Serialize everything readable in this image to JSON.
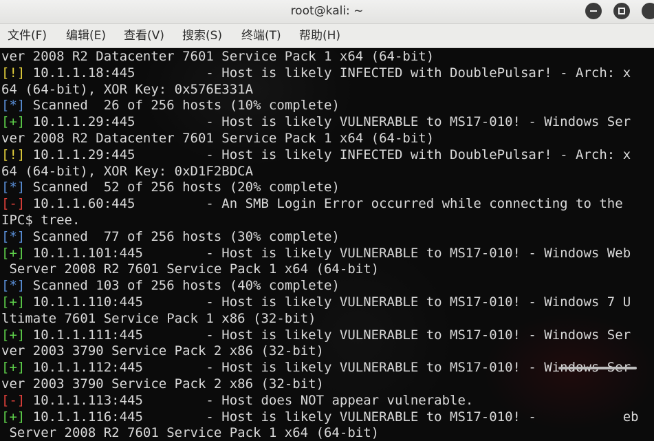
{
  "window": {
    "title": "root@kali: ~"
  },
  "menubar": {
    "items": [
      "文件(F)",
      "编辑(E)",
      "查看(V)",
      "搜索(S)",
      "终端(T)",
      "帮助(H)"
    ]
  },
  "terminal": {
    "lines": [
      {
        "tag": "",
        "text": "ver 2008 R2 Datacenter 7601 Service Pack 1 x64 (64-bit)"
      },
      {
        "tag": "[!]",
        "text": " 10.1.1.18:445         - Host is likely INFECTED with DoublePulsar! - Arch: x"
      },
      {
        "tag": "",
        "text": "64 (64-bit), XOR Key: 0x576E331A"
      },
      {
        "tag": "[*]",
        "text": " Scanned  26 of 256 hosts (10% complete)"
      },
      {
        "tag": "[+]",
        "text": " 10.1.1.29:445         - Host is likely VULNERABLE to MS17-010! - Windows Ser"
      },
      {
        "tag": "",
        "text": "ver 2008 R2 Datacenter 7601 Service Pack 1 x64 (64-bit)"
      },
      {
        "tag": "[!]",
        "text": " 10.1.1.29:445         - Host is likely INFECTED with DoublePulsar! - Arch: x"
      },
      {
        "tag": "",
        "text": "64 (64-bit), XOR Key: 0xD1F2BDCA"
      },
      {
        "tag": "[*]",
        "text": " Scanned  52 of 256 hosts (20% complete)"
      },
      {
        "tag": "[-]",
        "text": " 10.1.1.60:445         - An SMB Login Error occurred while connecting to the"
      },
      {
        "tag": "",
        "text": "IPC$ tree."
      },
      {
        "tag": "[*]",
        "text": " Scanned  77 of 256 hosts (30% complete)"
      },
      {
        "tag": "[+]",
        "text": " 10.1.1.101:445        - Host is likely VULNERABLE to MS17-010! - Windows Web"
      },
      {
        "tag": "",
        "text": " Server 2008 R2 7601 Service Pack 1 x64 (64-bit)"
      },
      {
        "tag": "[*]",
        "text": " Scanned 103 of 256 hosts (40% complete)"
      },
      {
        "tag": "[+]",
        "text": " 10.1.1.110:445        - Host is likely VULNERABLE to MS17-010! - Windows 7 U"
      },
      {
        "tag": "",
        "text": "ltimate 7601 Service Pack 1 x86 (32-bit)"
      },
      {
        "tag": "[+]",
        "text": " 10.1.1.111:445        - Host is likely VULNERABLE to MS17-010! - Windows Ser"
      },
      {
        "tag": "",
        "text": "ver 2003 3790 Service Pack 2 x86 (32-bit)"
      },
      {
        "tag": "[+]",
        "text": " 10.1.1.112:445        - Host is likely VULNERABLE to MS17-010! - Windows Ser"
      },
      {
        "tag": "",
        "text": "ver 2003 3790 Service Pack 2 x86 (32-bit)"
      },
      {
        "tag": "[-]",
        "text": " 10.1.1.113:445        - Host does NOT appear vulnerable."
      },
      {
        "tag": "[+]",
        "text": " 10.1.1.116:445        - Host is likely VULNERABLE to MS17-010! -           eb"
      },
      {
        "tag": "",
        "text": " Server 2008 R2 7601 Service Pack 1 x64 (64-bit)"
      }
    ]
  },
  "colors": {
    "info_tag": "#5a8fd8",
    "good_tag": "#5ed14a",
    "warn_tag": "#e6d23c",
    "bad_tag": "#e0403a",
    "text": "#d9d9d9",
    "background": "#0b0b0b"
  },
  "icons": {
    "minimize": "minimize-icon",
    "maximize": "maximize-icon",
    "close": "close-icon"
  }
}
